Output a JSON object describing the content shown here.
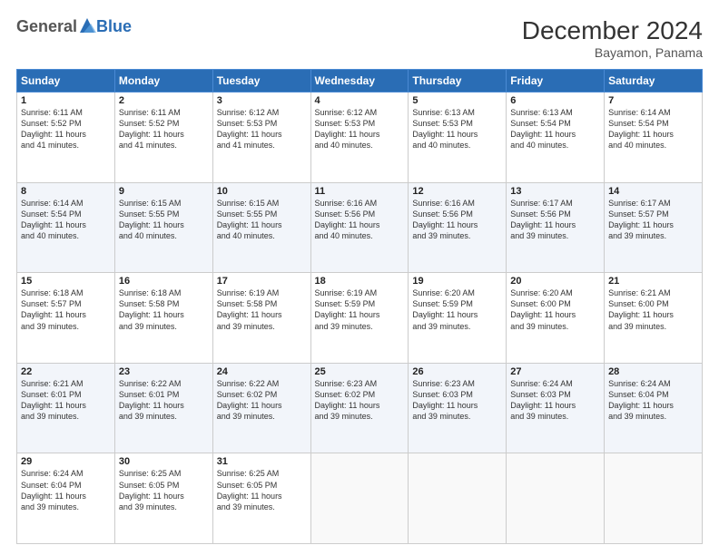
{
  "header": {
    "logo_general": "General",
    "logo_blue": "Blue",
    "main_title": "December 2024",
    "subtitle": "Bayamon, Panama"
  },
  "calendar": {
    "headers": [
      "Sunday",
      "Monday",
      "Tuesday",
      "Wednesday",
      "Thursday",
      "Friday",
      "Saturday"
    ],
    "rows": [
      [
        {
          "day": "1",
          "text": "Sunrise: 6:11 AM\nSunset: 5:52 PM\nDaylight: 11 hours\nand 41 minutes."
        },
        {
          "day": "2",
          "text": "Sunrise: 6:11 AM\nSunset: 5:52 PM\nDaylight: 11 hours\nand 41 minutes."
        },
        {
          "day": "3",
          "text": "Sunrise: 6:12 AM\nSunset: 5:53 PM\nDaylight: 11 hours\nand 41 minutes."
        },
        {
          "day": "4",
          "text": "Sunrise: 6:12 AM\nSunset: 5:53 PM\nDaylight: 11 hours\nand 40 minutes."
        },
        {
          "day": "5",
          "text": "Sunrise: 6:13 AM\nSunset: 5:53 PM\nDaylight: 11 hours\nand 40 minutes."
        },
        {
          "day": "6",
          "text": "Sunrise: 6:13 AM\nSunset: 5:54 PM\nDaylight: 11 hours\nand 40 minutes."
        },
        {
          "day": "7",
          "text": "Sunrise: 6:14 AM\nSunset: 5:54 PM\nDaylight: 11 hours\nand 40 minutes."
        }
      ],
      [
        {
          "day": "8",
          "text": "Sunrise: 6:14 AM\nSunset: 5:54 PM\nDaylight: 11 hours\nand 40 minutes."
        },
        {
          "day": "9",
          "text": "Sunrise: 6:15 AM\nSunset: 5:55 PM\nDaylight: 11 hours\nand 40 minutes."
        },
        {
          "day": "10",
          "text": "Sunrise: 6:15 AM\nSunset: 5:55 PM\nDaylight: 11 hours\nand 40 minutes."
        },
        {
          "day": "11",
          "text": "Sunrise: 6:16 AM\nSunset: 5:56 PM\nDaylight: 11 hours\nand 40 minutes."
        },
        {
          "day": "12",
          "text": "Sunrise: 6:16 AM\nSunset: 5:56 PM\nDaylight: 11 hours\nand 39 minutes."
        },
        {
          "day": "13",
          "text": "Sunrise: 6:17 AM\nSunset: 5:56 PM\nDaylight: 11 hours\nand 39 minutes."
        },
        {
          "day": "14",
          "text": "Sunrise: 6:17 AM\nSunset: 5:57 PM\nDaylight: 11 hours\nand 39 minutes."
        }
      ],
      [
        {
          "day": "15",
          "text": "Sunrise: 6:18 AM\nSunset: 5:57 PM\nDaylight: 11 hours\nand 39 minutes."
        },
        {
          "day": "16",
          "text": "Sunrise: 6:18 AM\nSunset: 5:58 PM\nDaylight: 11 hours\nand 39 minutes."
        },
        {
          "day": "17",
          "text": "Sunrise: 6:19 AM\nSunset: 5:58 PM\nDaylight: 11 hours\nand 39 minutes."
        },
        {
          "day": "18",
          "text": "Sunrise: 6:19 AM\nSunset: 5:59 PM\nDaylight: 11 hours\nand 39 minutes."
        },
        {
          "day": "19",
          "text": "Sunrise: 6:20 AM\nSunset: 5:59 PM\nDaylight: 11 hours\nand 39 minutes."
        },
        {
          "day": "20",
          "text": "Sunrise: 6:20 AM\nSunset: 6:00 PM\nDaylight: 11 hours\nand 39 minutes."
        },
        {
          "day": "21",
          "text": "Sunrise: 6:21 AM\nSunset: 6:00 PM\nDaylight: 11 hours\nand 39 minutes."
        }
      ],
      [
        {
          "day": "22",
          "text": "Sunrise: 6:21 AM\nSunset: 6:01 PM\nDaylight: 11 hours\nand 39 minutes."
        },
        {
          "day": "23",
          "text": "Sunrise: 6:22 AM\nSunset: 6:01 PM\nDaylight: 11 hours\nand 39 minutes."
        },
        {
          "day": "24",
          "text": "Sunrise: 6:22 AM\nSunset: 6:02 PM\nDaylight: 11 hours\nand 39 minutes."
        },
        {
          "day": "25",
          "text": "Sunrise: 6:23 AM\nSunset: 6:02 PM\nDaylight: 11 hours\nand 39 minutes."
        },
        {
          "day": "26",
          "text": "Sunrise: 6:23 AM\nSunset: 6:03 PM\nDaylight: 11 hours\nand 39 minutes."
        },
        {
          "day": "27",
          "text": "Sunrise: 6:24 AM\nSunset: 6:03 PM\nDaylight: 11 hours\nand 39 minutes."
        },
        {
          "day": "28",
          "text": "Sunrise: 6:24 AM\nSunset: 6:04 PM\nDaylight: 11 hours\nand 39 minutes."
        }
      ],
      [
        {
          "day": "29",
          "text": "Sunrise: 6:24 AM\nSunset: 6:04 PM\nDaylight: 11 hours\nand 39 minutes."
        },
        {
          "day": "30",
          "text": "Sunrise: 6:25 AM\nSunset: 6:05 PM\nDaylight: 11 hours\nand 39 minutes."
        },
        {
          "day": "31",
          "text": "Sunrise: 6:25 AM\nSunset: 6:05 PM\nDaylight: 11 hours\nand 39 minutes."
        },
        {
          "day": "",
          "text": ""
        },
        {
          "day": "",
          "text": ""
        },
        {
          "day": "",
          "text": ""
        },
        {
          "day": "",
          "text": ""
        }
      ]
    ]
  }
}
